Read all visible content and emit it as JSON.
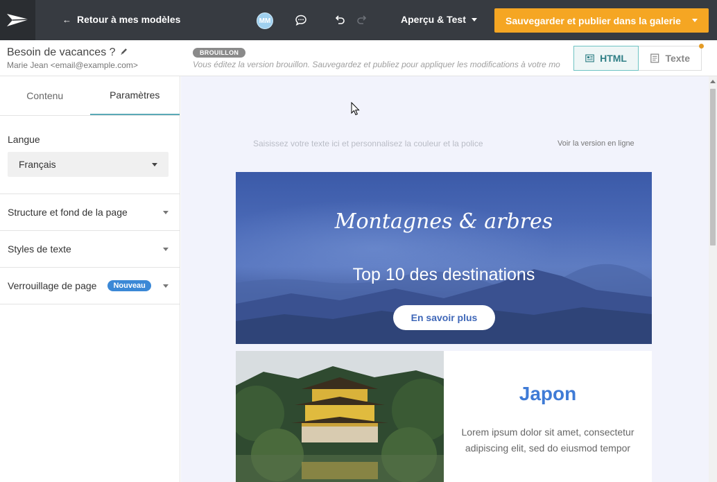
{
  "topbar": {
    "back_label": "Retour à mes modèles",
    "avatar_initials": "MM",
    "preview_label": "Aperçu & Test",
    "publish_label": "Sauvegarder et publier dans la galerie"
  },
  "document": {
    "title": "Besoin de vacances ?",
    "sender": "Marie Jean <email@example.com>",
    "status_badge": "BROUILLON",
    "draft_note": "Vous éditez la version brouillon. Sauvegardez et publiez pour appliquer les modifications à votre mo"
  },
  "view_toggle": {
    "html_label": "HTML",
    "text_label": "Texte",
    "active": "HTML"
  },
  "sidebar": {
    "tabs": [
      {
        "label": "Contenu",
        "active": false
      },
      {
        "label": "Paramètres",
        "active": true
      }
    ],
    "language": {
      "label": "Langue",
      "selected": "Français"
    },
    "sections": [
      {
        "label": "Structure et fond de la page"
      },
      {
        "label": "Styles de texte"
      },
      {
        "label": "Verrouillage de page",
        "badge": "Nouveau"
      }
    ]
  },
  "email": {
    "preheader": "Saisissez votre texte ici et personnalisez la couleur et la police",
    "online_link": "Voir la version en ligne",
    "hero": {
      "title": "Montagnes & arbres",
      "subtitle": "Top 10 des destinations",
      "button": "En savoir plus"
    },
    "card": {
      "heading": "Japon",
      "text": "Lorem ipsum dolor sit amet, consectetur adipiscing elit, sed do eiusmod tempor"
    }
  },
  "colors": {
    "topbar_bg": "#373b41",
    "publish_orange": "#f5a623",
    "toggle_teal": "#2f7f86",
    "new_badge_blue": "#3b88d6",
    "heading_blue": "#3f7bd6",
    "canvas_bg": "#f2f3fc"
  }
}
